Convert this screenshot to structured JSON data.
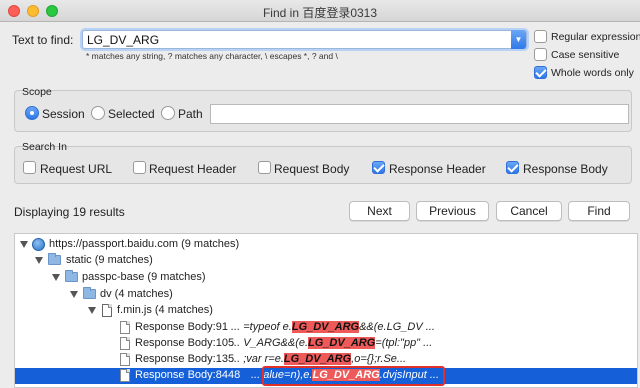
{
  "window": {
    "title": "Find in 百度登录0313"
  },
  "find": {
    "label": "Text to find:",
    "value": "LG_DV_ARG",
    "hint": "* matches any string, ? matches any character, \\ escapes *, ? and \\"
  },
  "options": [
    {
      "label": "Regular expression",
      "checked": false
    },
    {
      "label": "Case sensitive",
      "checked": false
    },
    {
      "label": "Whole words only",
      "checked": true
    }
  ],
  "scope": {
    "title": "Scope",
    "items": [
      {
        "label": "Session",
        "selected": true
      },
      {
        "label": "Selected",
        "selected": false
      },
      {
        "label": "Path",
        "selected": false
      }
    ],
    "path_value": ""
  },
  "search_in": {
    "title": "Search In",
    "items": [
      {
        "label": "Request URL",
        "checked": false
      },
      {
        "label": "Request Header",
        "checked": false
      },
      {
        "label": "Request Body",
        "checked": false
      },
      {
        "label": "Response Header",
        "checked": true
      },
      {
        "label": "Response Body",
        "checked": true
      }
    ]
  },
  "results": {
    "summary": "Displaying 19 results",
    "buttons": {
      "next": "Next",
      "previous": "Previous",
      "cancel": "Cancel",
      "find": "Find"
    }
  },
  "tree": {
    "host": "https://passport.baidu.com (9 matches)",
    "static": "static (9 matches)",
    "passpc": "passpc-base (9 matches)",
    "dv": "dv (4 matches)",
    "file": "f.min.js (4 matches)",
    "matches": [
      {
        "label": "Response Body:91",
        "pre": "... =typeof e.",
        "hit": "LG_DV_ARG",
        "post": "&&(e.LG_DV ..."
      },
      {
        "label": "Response Body:105",
        "pre": "... V_ARG&&(e.",
        "hit": "LG_DV_ARG",
        "post": "=(tpl:\"pp\" ..."
      },
      {
        "label": "Response Body:135",
        "pre": "... ;var r=e.",
        "hit": "LG_DV_ARG",
        "post": ",o={};r.Se..."
      },
      {
        "label": "Response Body:8448",
        "pre": "... alue=n),e.",
        "hit": "LG_DV_ARG",
        "post": ".dvjsInput ..."
      }
    ]
  },
  "colors": {
    "accent": "#2f78e8",
    "selection": "#1560d8",
    "highlight": "#ee5a5a",
    "annotation": "#e0302a"
  }
}
